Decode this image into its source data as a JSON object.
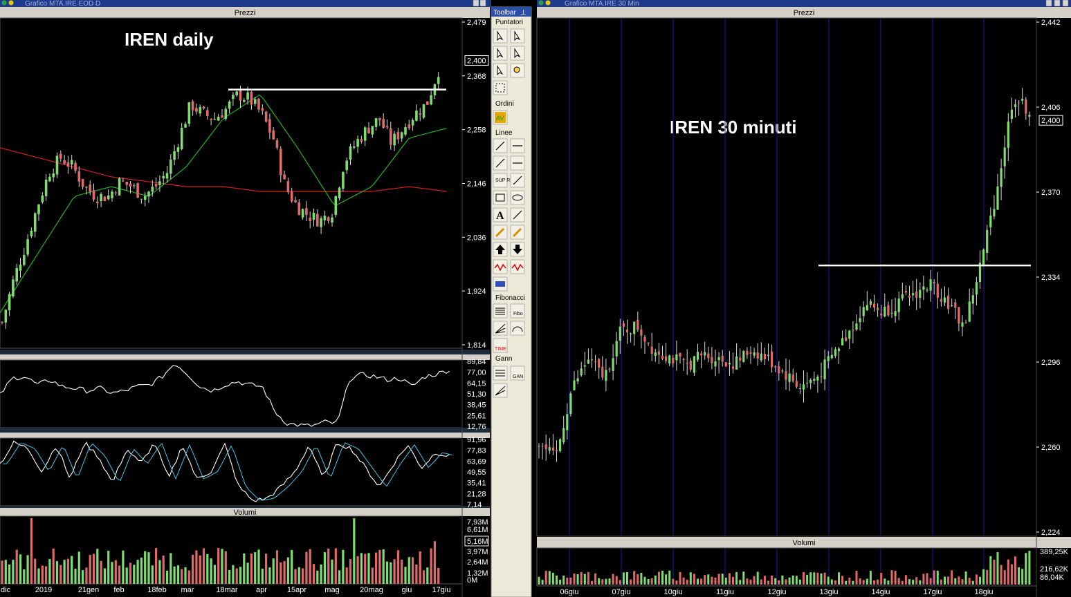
{
  "left_window": {
    "title": "Grafico MTA.IRE EOD D",
    "annotation": "IREN daily",
    "panel_prices_title": "Prezzi",
    "panel_volume_title": "Volumi",
    "panel_separator": "..."
  },
  "right_window": {
    "title": "Grafico MTA.IRE 30 Min",
    "annotation": "IREN 30 minuti",
    "panel_prices_title": "Prezzi",
    "panel_volume_title": "Volumi"
  },
  "toolbar": {
    "title": "Toolbar",
    "pin_icon": "pin-icon",
    "sections": [
      "Puntatori",
      "Ordini",
      "Linee",
      "Fibonacci",
      "Gann"
    ],
    "button_sup_res": "SUP RES",
    "button_time": "TIME",
    "button_fibo": "Fibo",
    "button_gan": "GAN",
    "button_av": "AV"
  },
  "colors": {
    "bull": "#7fdc6f",
    "bear": "#e06a6a",
    "ma_red": "#d21f1f",
    "ma_green": "#22b422",
    "cyan": "#46c6e6",
    "grid_blue": "#1a1aa0",
    "panel_bg": "#000000",
    "title_bar": "#1e3a8a"
  },
  "chart_data": [
    {
      "id": "left-price",
      "type": "candlestick",
      "title": "Prezzi",
      "annotation": "IREN daily",
      "y_ticks": [
        "2,479",
        "2,368",
        "2,258",
        "2,146",
        "2,036",
        "1,924",
        "1,814"
      ],
      "ylim": [
        1.814,
        2.479
      ],
      "last_price": "2,400",
      "x_ticks": [
        "dic",
        "2019",
        "21gen",
        "feb",
        "18feb",
        "mar",
        "18mar",
        "apr",
        "15apr",
        "mag",
        "20mag",
        "giu",
        "17giu"
      ],
      "resistance_level": 2.34,
      "moving_averages": [
        {
          "color": "red",
          "values": [
            2.22,
            2.2,
            2.18,
            2.16,
            2.15,
            2.14,
            2.14,
            2.13,
            2.13,
            2.13,
            2.13,
            2.14,
            2.13
          ]
        },
        {
          "color": "green",
          "values": [
            1.88,
            2.0,
            2.12,
            2.14,
            2.12,
            2.18,
            2.28,
            2.33,
            2.22,
            2.1,
            2.14,
            2.24,
            2.26
          ]
        }
      ]
    },
    {
      "id": "left-osc1",
      "type": "line",
      "y_ticks": [
        "89,84",
        "77,00",
        "64,15",
        "51,30",
        "38,45",
        "25,61",
        "12,76"
      ],
      "ylim": [
        12.76,
        89.84
      ]
    },
    {
      "id": "left-osc2",
      "type": "line",
      "y_ticks": [
        "91,96",
        "77,83",
        "63,69",
        "49,55",
        "35,41",
        "21,28",
        "7,14"
      ],
      "ylim": [
        7.14,
        91.96
      ]
    },
    {
      "id": "left-volume",
      "type": "bar",
      "title": "Volumi",
      "y_ticks": [
        "7,93M",
        "6,61M",
        "5,16M",
        "3,97M",
        "2,64M",
        "1,32M",
        "0M"
      ],
      "last_value": "5,16M"
    },
    {
      "id": "right-price",
      "type": "candlestick",
      "title": "Prezzi",
      "annotation": "IREN 30 minuti",
      "y_ticks": [
        "2,442",
        "2,406",
        "2,370",
        "2,334",
        "2,296",
        "2,260",
        "2,224"
      ],
      "ylim": [
        2.224,
        2.442
      ],
      "last_price": "2,400",
      "x_ticks": [
        "06giu",
        "07giu",
        "10giu",
        "11giu",
        "12giu",
        "13giu",
        "14giu",
        "17giu",
        "18giu"
      ],
      "resistance_level": 2.338
    },
    {
      "id": "right-volume",
      "type": "bar",
      "title": "Volumi",
      "y_ticks": [
        "389,25K",
        "216,62K",
        "86,04K"
      ],
      "last_value": "216,62K"
    }
  ]
}
